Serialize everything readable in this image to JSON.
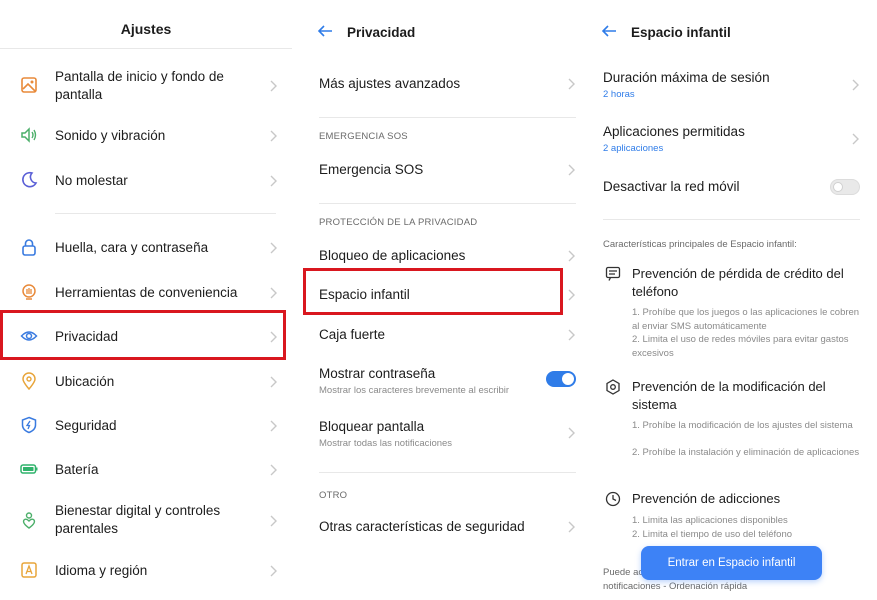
{
  "settings": {
    "title": "Ajustes",
    "items": [
      {
        "label": "Pantalla de inicio y fondo de pantalla",
        "icon": "wallpaper-icon"
      },
      {
        "label": "Sonido y vibración",
        "icon": "speaker-icon"
      },
      {
        "label": "No molestar",
        "icon": "moon-icon"
      },
      {
        "label": "Huella, cara y contraseña",
        "icon": "lock-icon"
      },
      {
        "label": "Herramientas de conveniencia",
        "icon": "hand-icon"
      },
      {
        "label": "Privacidad",
        "icon": "privacy-eye-icon"
      },
      {
        "label": "Ubicación",
        "icon": "location-pin-icon"
      },
      {
        "label": "Seguridad",
        "icon": "shield-icon"
      },
      {
        "label": "Batería",
        "icon": "battery-icon"
      },
      {
        "label": "Bienestar digital y controles parentales",
        "icon": "wellbeing-icon"
      },
      {
        "label": "Idioma y región",
        "icon": "language-icon"
      }
    ]
  },
  "privacy": {
    "title": "Privacidad",
    "advanced": "Más ajustes avanzados",
    "section_sos": "EMERGENCIA SOS",
    "sos": "Emergencia SOS",
    "section_privacy": "PROTECCIÓN DE LA PRIVACIDAD",
    "app_lock": "Bloqueo de aplicaciones",
    "kid_space": "Espacio infantil",
    "safe_box": "Caja fuerte",
    "show_password": "Mostrar contraseña",
    "show_password_sub": "Mostrar los caracteres brevemente al escribir",
    "lock_screen": "Bloquear pantalla",
    "lock_screen_sub": "Mostrar todas las notificaciones",
    "section_other": "OTRO",
    "other_security": "Otras características de seguridad"
  },
  "kid_space": {
    "title": "Espacio infantil",
    "max_session": "Duración máxima de sesión",
    "max_session_value": "2 horas",
    "allowed_apps": "Aplicaciones permitidas",
    "allowed_apps_value": "2 aplicaciones",
    "disable_mobile": "Desactivar la red móvil",
    "intro": "Características principales de Espacio infantil:",
    "features": [
      {
        "title": "Prevención de pérdida de crédito del teléfono",
        "desc1": "1. Prohíbe que los juegos o las aplicaciones le cobren al enviar SMS automáticamente",
        "desc2": "2. Limita el uso de redes móviles para evitar gastos excesivos"
      },
      {
        "title": "Prevención de la modificación del sistema",
        "desc1": "1. Prohíbe la modificación de los ajustes del sistema",
        "desc2": "2. Prohíbe la instalación y eliminación de aplicaciones"
      },
      {
        "title": "Prevención de adicciones",
        "desc1": "1. Limita las aplicaciones disponibles",
        "desc2": "2. Limita el tiempo de uso del teléfono"
      }
    ],
    "footer": "Puede acceder a \"Espacio infantil\" en \"Centro de notificaciones - Ordenación rápida",
    "enter_button": "Entrar en Espacio infantil"
  },
  "colors": {
    "accent": "#2f7ce8",
    "highlight": "#d9171f",
    "button": "#3d82f6"
  }
}
